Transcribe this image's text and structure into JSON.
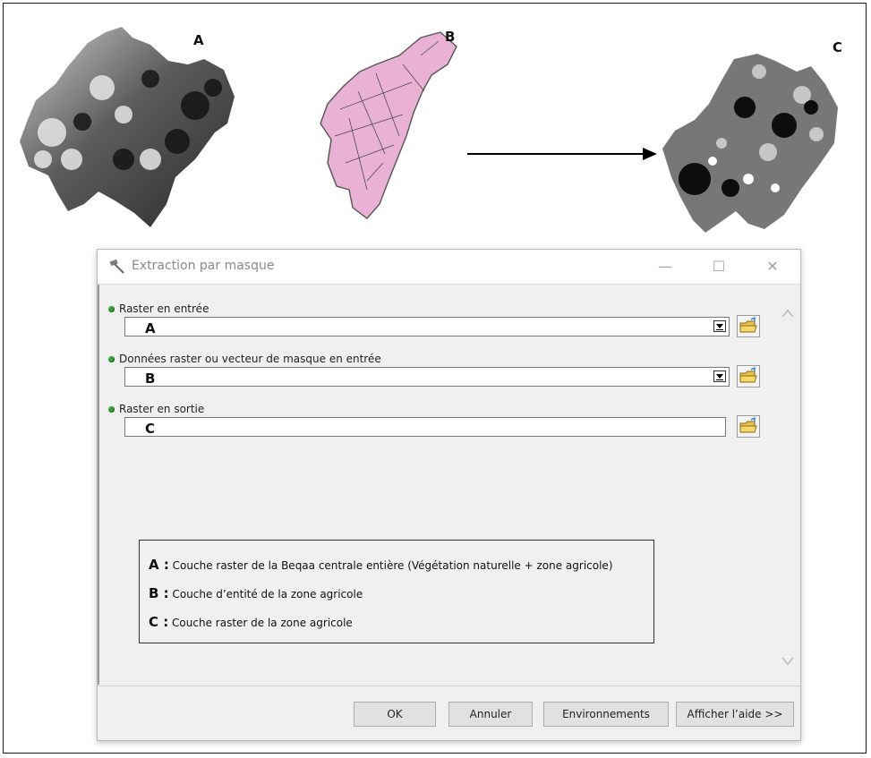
{
  "maps": {
    "a_label": "A",
    "b_label": "B",
    "c_label": "C"
  },
  "dialog": {
    "title": "Extraction par masque",
    "window_controls": {
      "minimize": "—",
      "maximize": "☐",
      "close": "✕"
    },
    "params": [
      {
        "label": "Raster en entrée",
        "value": "A"
      },
      {
        "label": "Données raster ou vecteur de masque en entrée",
        "value": "B"
      },
      {
        "label": "Raster en sortie",
        "value": "C"
      }
    ],
    "legend": [
      {
        "key": "A :",
        "text": " Couche raster de la Beqaa centrale entière  (Végétation naturelle + zone agricole)"
      },
      {
        "key": "B :",
        "text": " Couche d’entité de la zone agricole"
      },
      {
        "key": "C :",
        "text": " Couche raster de la zone agricole"
      }
    ],
    "buttons": {
      "ok": "OK",
      "cancel": "Annuler",
      "environments": "Environnements",
      "help": "Afficher l’aide >>"
    }
  },
  "colors": {
    "param_dot": "#3aa53a",
    "mask_fill": "#e9b2d4",
    "dialog_bg": "#f0f0f0"
  }
}
